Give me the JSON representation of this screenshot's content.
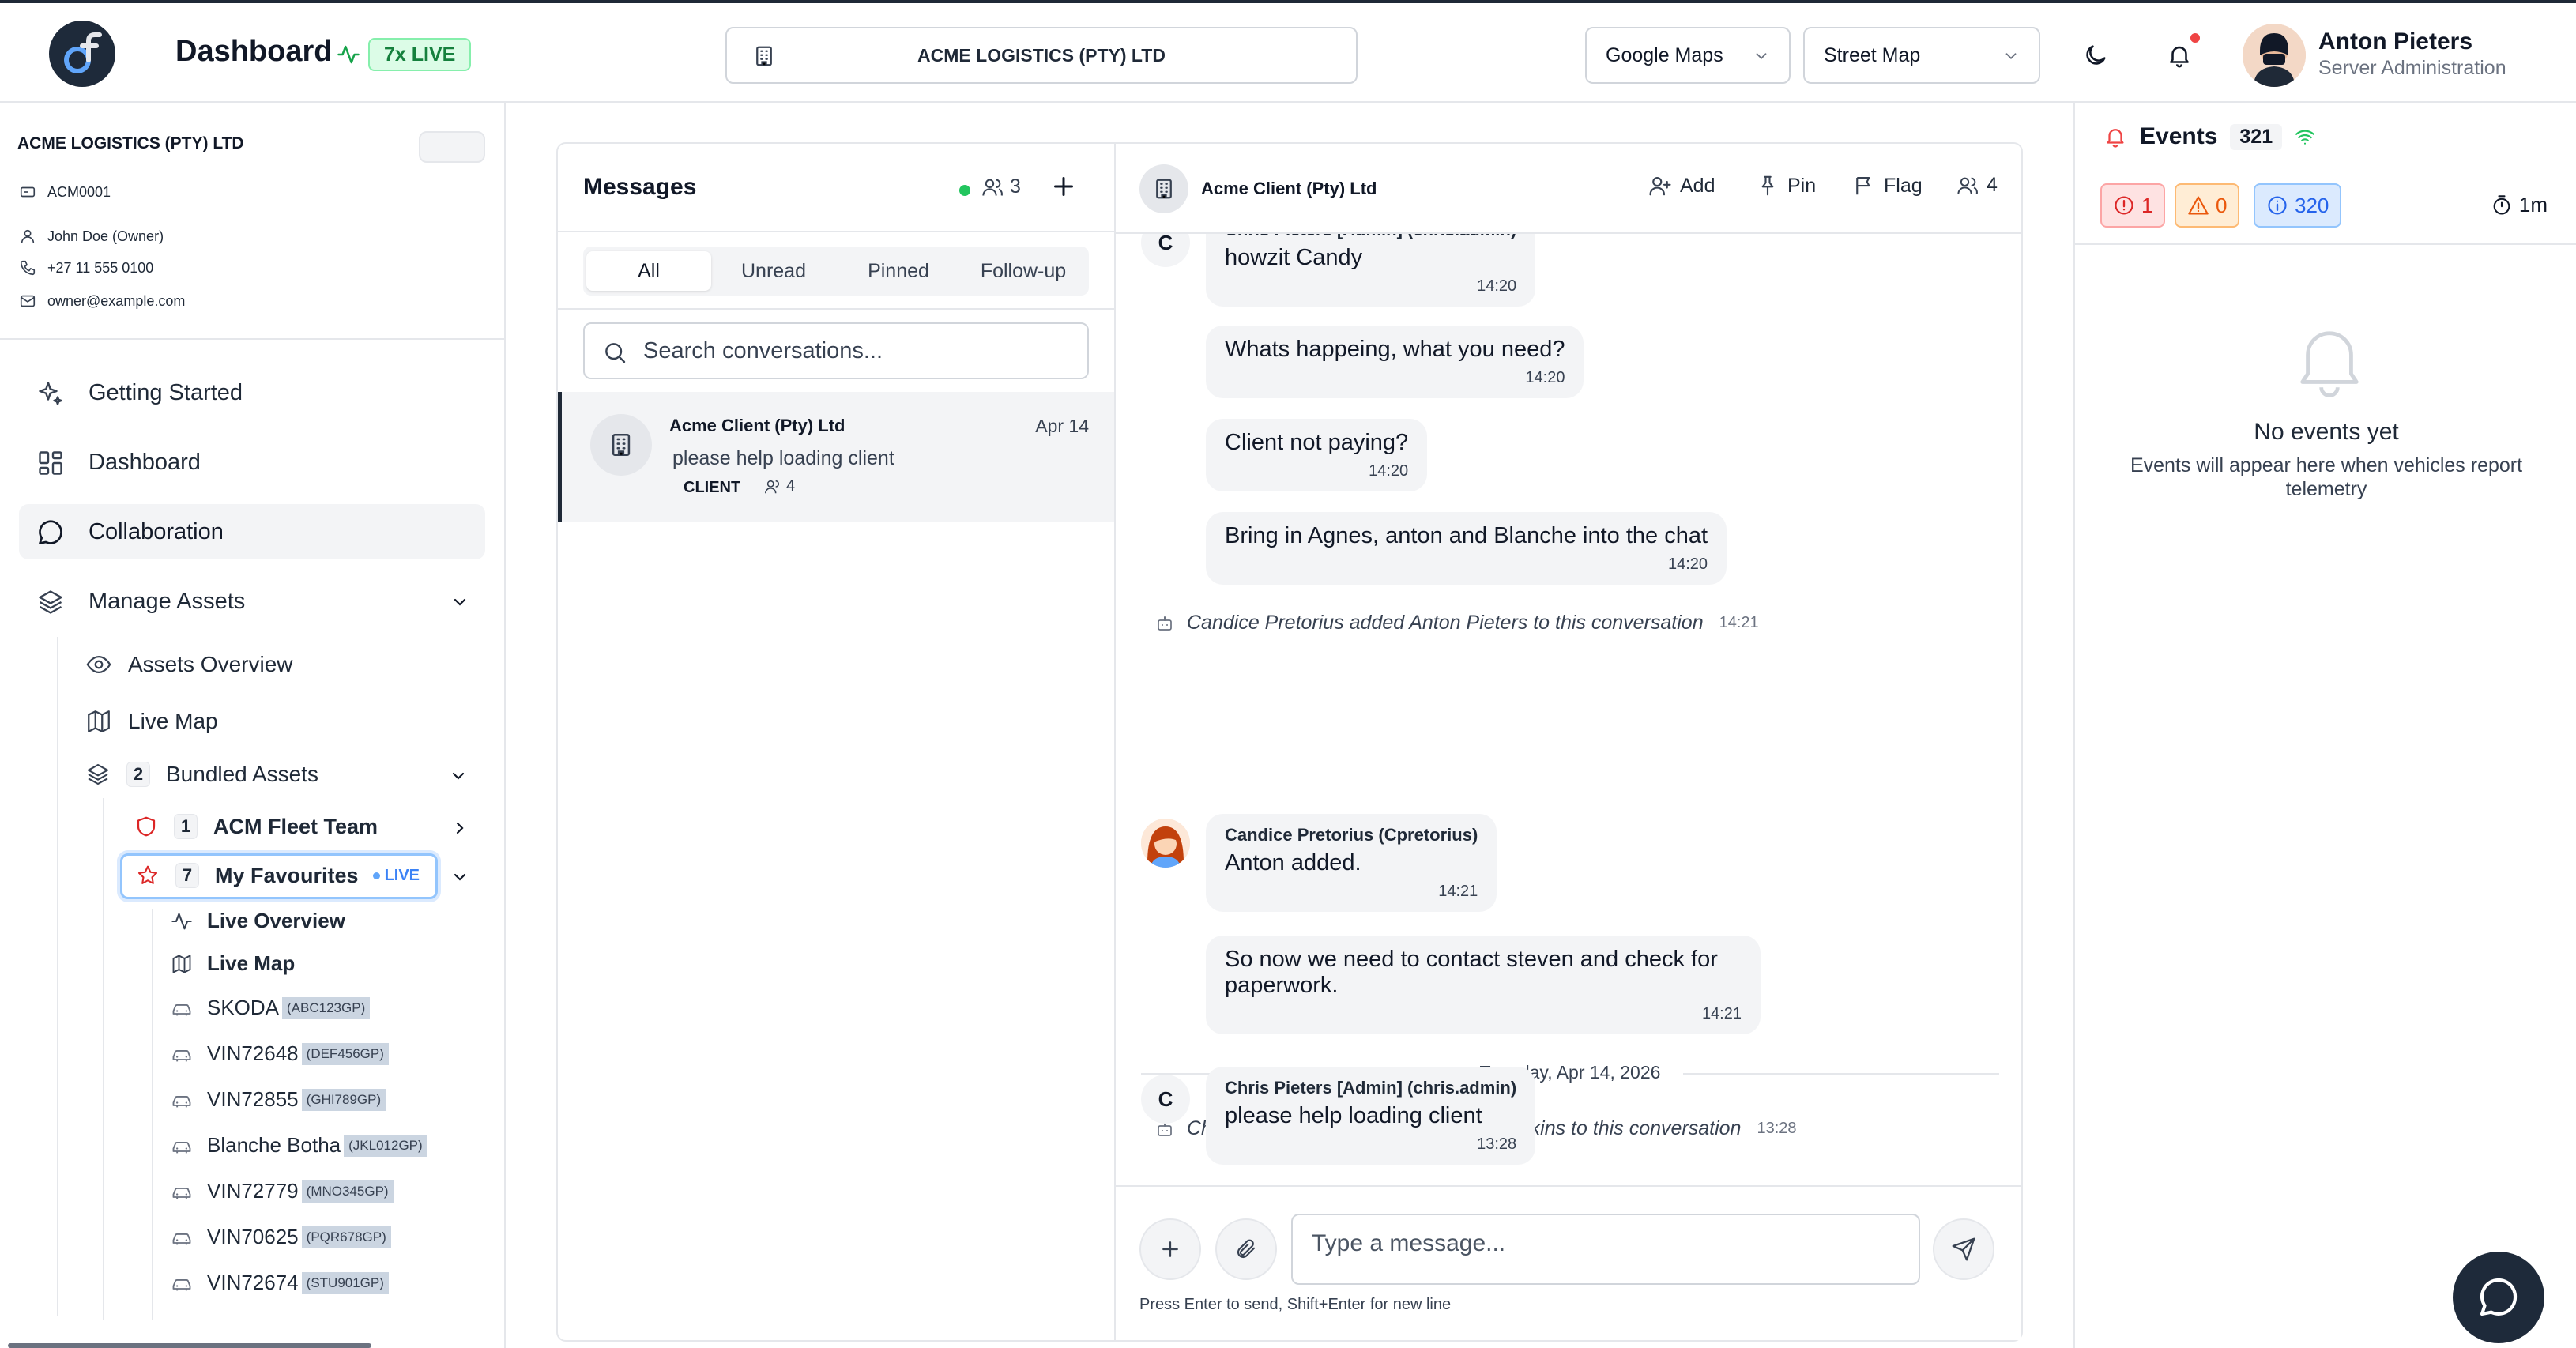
{
  "header": {
    "title": "Dashboard",
    "live_badge": "7x LIVE",
    "company": "ACME LOGISTICS (PTY) LTD",
    "map_provider": "Google Maps",
    "map_style": "Street Map",
    "user": {
      "name": "Anton Pieters",
      "role": "Server Administration"
    }
  },
  "org": {
    "name": "ACME LOGISTICS (PTY) LTD",
    "code": "ACM0001",
    "owner": "John Doe (Owner)",
    "phone": "+27 11 555 0100",
    "email": "owner@example.com"
  },
  "nav": {
    "getting_started": "Getting Started",
    "dashboard": "Dashboard",
    "collaboration": "Collaboration",
    "manage_assets": "Manage Assets",
    "assets_overview": "Assets Overview",
    "live_map": "Live Map",
    "bundled_assets": "Bundled Assets",
    "bundled_count": "2",
    "fleet_team": "ACM Fleet Team",
    "fleet_count": "1",
    "favourites": "My Favourites",
    "favourites_count": "7",
    "favourites_live": "LIVE",
    "live_overview": "Live Overview",
    "fav_live_map": "Live Map",
    "vehicles": [
      {
        "name": "SKODA",
        "plate": "(ABC123GP)"
      },
      {
        "name": "VIN72648",
        "plate": "(DEF456GP)"
      },
      {
        "name": "VIN72855",
        "plate": "(GHI789GP)"
      },
      {
        "name": "Blanche Botha",
        "plate": "(JKL012GP)"
      },
      {
        "name": "VIN72779",
        "plate": "(MNO345GP)"
      },
      {
        "name": "VIN70625",
        "plate": "(PQR678GP)"
      },
      {
        "name": "VIN72674",
        "plate": "(STU901GP)"
      }
    ]
  },
  "messages": {
    "title": "Messages",
    "online_count": "3",
    "tabs": [
      "All",
      "Unread",
      "Pinned",
      "Follow-up"
    ],
    "search_placeholder": "Search conversations...",
    "conversation": {
      "name": "Acme Client (Pty) Ltd",
      "date": "Apr 14",
      "preview": "please help loading client",
      "tag": "CLIENT",
      "members": "4"
    }
  },
  "chat": {
    "name": "Acme Client (Pty) Ltd",
    "actions": {
      "add": "Add",
      "pin": "Pin",
      "flag": "Flag",
      "members": "4"
    },
    "msgs": [
      {
        "sender": "Chris Pieters [Admin] (chris.admin)",
        "text": "howzit Candy",
        "time": "14:20",
        "avatar": "C"
      },
      {
        "text": "Whats happeing, what you need?",
        "time": "14:20"
      },
      {
        "text": "Client not paying?",
        "time": "14:20"
      },
      {
        "text": "Bring in Agnes, anton and Blanche into the chat",
        "time": "14:20"
      },
      {
        "system": "Candice Pretorius added Anton Pieters to this conversation",
        "time": "14:21"
      },
      {
        "sender": "Candice Pretorius (Cpretorius)",
        "text": "Anton added.",
        "time": "14:21"
      },
      {
        "text": "So now we need to contact steven and check for paperwork.",
        "time": "14:21"
      },
      {
        "date": "Tuesday, Apr 14, 2026"
      },
      {
        "system": "Chris Pieters [Admin] added marius Wilkins to this conversation",
        "time": "13:28"
      },
      {
        "sender": "Chris Pieters [Admin] (chris.admin)",
        "text": "please help loading client",
        "time": "13:28",
        "avatar": "C"
      }
    ],
    "input_placeholder": "Type a message...",
    "hint": "Press Enter to send, Shift+Enter for new line"
  },
  "events": {
    "title": "Events",
    "count": "321",
    "critical": "1",
    "warning": "0",
    "info": "320",
    "interval": "1m",
    "empty_title": "No events yet",
    "empty_sub": "Events will appear here when vehicles report telemetry"
  },
  "colors": {
    "accent_dark": "#1e2a3a",
    "live_green": "#15803d",
    "critical_red": "#dc2626",
    "warning_orange": "#ea580c",
    "info_blue": "#2563eb"
  }
}
